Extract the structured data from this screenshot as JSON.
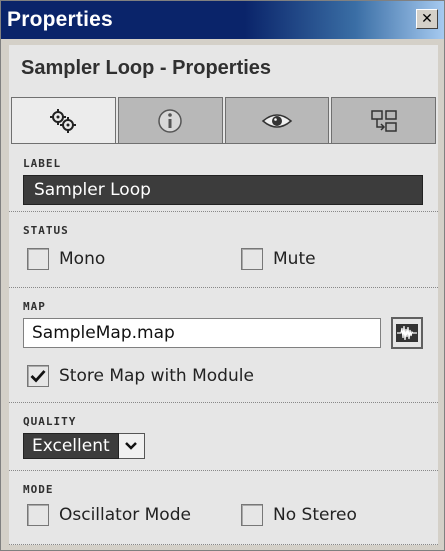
{
  "window": {
    "title": "Properties",
    "close_glyph": "✕"
  },
  "panel": {
    "title": "Sampler Loop - Properties"
  },
  "tabs": [
    {
      "icon": "gears-icon",
      "active": true
    },
    {
      "icon": "info-icon",
      "active": false
    },
    {
      "icon": "eye-icon",
      "active": false
    },
    {
      "icon": "routing-icon",
      "active": false
    }
  ],
  "label_section": {
    "heading": "LABEL",
    "value": "Sampler Loop"
  },
  "status_section": {
    "heading": "STATUS",
    "mono_label": "Mono",
    "mono_checked": false,
    "mute_label": "Mute",
    "mute_checked": false
  },
  "map_section": {
    "heading": "MAP",
    "map_value": "SampleMap.map",
    "button_icon": "waveform-icon",
    "store_label": "Store Map with Module",
    "store_checked": true
  },
  "quality_section": {
    "heading": "QUALITY",
    "selected": "Excellent"
  },
  "mode_section": {
    "heading": "MODE",
    "oscillator_label": "Oscillator Mode",
    "oscillator_checked": false,
    "nostereo_label": "No Stereo",
    "nostereo_checked": false
  }
}
